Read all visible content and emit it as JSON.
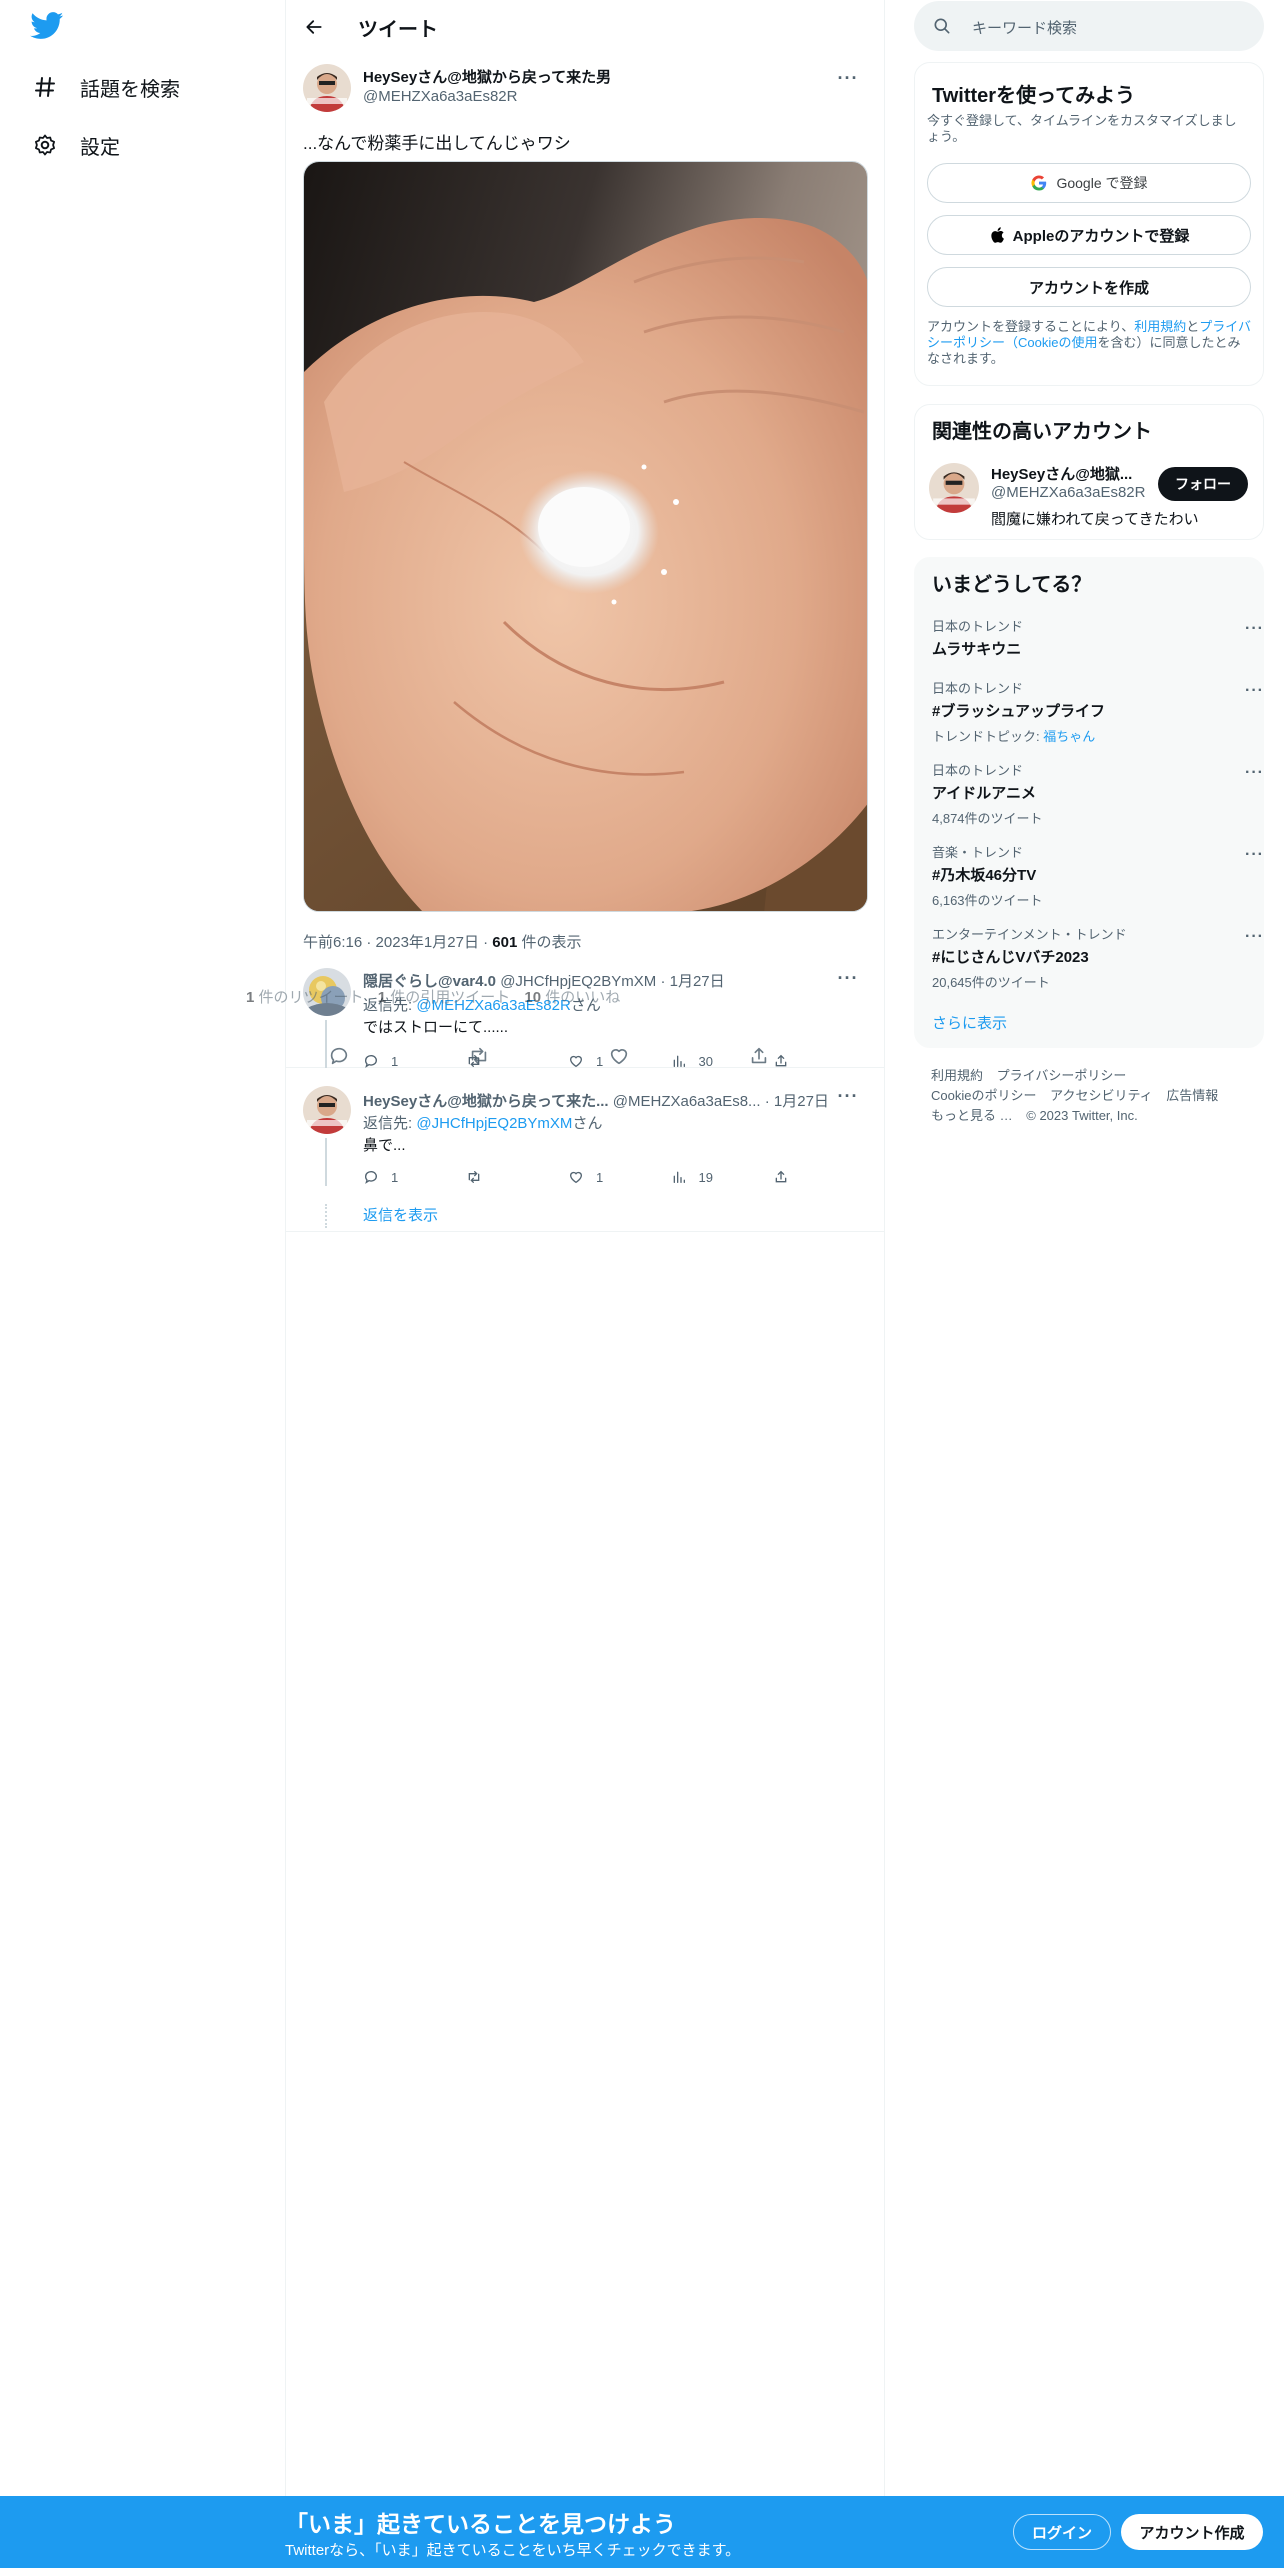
{
  "colors": {
    "accent": "#1d9bf0",
    "text": "#0f1419",
    "secondary": "#536471",
    "border": "#eff3f4"
  },
  "left_nav": {
    "logo_icon": "twitter-bird-icon",
    "items": [
      {
        "label": "話題を検索",
        "icon": "hashtag-icon"
      },
      {
        "label": "設定",
        "icon": "gear-icon"
      }
    ]
  },
  "header": {
    "back_icon": "arrow-left-icon",
    "title": "ツイート"
  },
  "main_tweet": {
    "display_name": "HeySeyさん@地獄から戻って来た男",
    "handle": "@MEHZXa6a3aEs82R",
    "text": "...なんで粉薬手に出してんじゃワシ",
    "photo_description": "hand-with-white-granules-photo",
    "time": "午前6:16",
    "date": "2023年1月27日",
    "views_count": "601",
    "views_label": "件の表示",
    "retweets_count": "1",
    "retweets_label": "件のリツイート",
    "quotes_count": "1",
    "quotes_label": "件の引用ツイート",
    "likes_count": "10",
    "likes_label": "件のいいね"
  },
  "replies": [
    {
      "display_name": "隠居ぐらし@var4.0",
      "handle": "@JHCfHpjEQ2BYmXM",
      "date": "1月27日",
      "reply_to_prefix": "返信先: ",
      "reply_to_handle": "@MEHZXa6a3aEs82R",
      "reply_to_suffix": "さん",
      "text": "ではストローにて......",
      "reply_count": "1",
      "retweet_count": "",
      "like_count": "1",
      "view_count": "30"
    },
    {
      "display_name": "HeySeyさん@地獄から戻って来た...",
      "handle": "@MEHZXa6a3aEs8...",
      "date": "1月27日",
      "reply_to_prefix": "返信先: ",
      "reply_to_handle": "@JHCfHpjEQ2BYmXM",
      "reply_to_suffix": "さん",
      "text": "鼻で...",
      "reply_count": "1",
      "retweet_count": "",
      "like_count": "1",
      "view_count": "19"
    }
  ],
  "show_replies": "返信を表示",
  "search": {
    "placeholder": "キーワード検索"
  },
  "signup_card": {
    "title": "Twitterを使ってみよう",
    "subtitle": "今すぐ登録して、タイムラインをカスタマイズしましょう。",
    "google_label": "Google で登録",
    "apple_label": "Appleのアカウントで登録",
    "create_label": "アカウントを作成",
    "terms_prefix": "アカウントを登録することにより、",
    "terms_link1": "利用規約",
    "terms_and": "と",
    "terms_link2": "プライバシーポリシー（Cookieの使用",
    "terms_suffix": "を含む）に同意したとみなされます。"
  },
  "related_card": {
    "title": "関連性の高いアカウント",
    "name": "HeySeyさん@地獄...",
    "handle": "@MEHZXa6a3aEs82R",
    "bio": "閻魔に嫌われて戻ってきたわい",
    "follow_label": "フォロー"
  },
  "trends_card": {
    "title": "いまどうしてる？",
    "items": [
      {
        "category": "日本のトレンド",
        "name": "ムラサキウニ",
        "count": "",
        "topic_prefix": "",
        "topic_link": ""
      },
      {
        "category": "日本のトレンド",
        "name": "#ブラッシュアップライフ",
        "count": "",
        "topic_prefix": "トレンドトピック: ",
        "topic_link": "福ちゃん"
      },
      {
        "category": "日本のトレンド",
        "name": "アイドルアニメ",
        "count": "4,874件のツイート",
        "topic_prefix": "",
        "topic_link": ""
      },
      {
        "category": "音楽・トレンド",
        "name": "#乃木坂46分TV",
        "count": "6,163件のツイート",
        "topic_prefix": "",
        "topic_link": ""
      },
      {
        "category": "エンターテインメント・トレンド",
        "name": "#にじさんじVバチ2023",
        "count": "20,645件のツイート",
        "topic_prefix": "",
        "topic_link": ""
      }
    ],
    "show_more": "さらに表示"
  },
  "footer": {
    "links": [
      "利用規約",
      "プライバシーポリシー",
      "Cookieのポリシー",
      "アクセシビリティ",
      "広告情報",
      "もっと見る …",
      "© 2023 Twitter, Inc."
    ]
  },
  "bottom_bar": {
    "title": "「いま」起きていることを見つけよう",
    "subtitle": "Twitterなら、「いま」起きていることをいち早くチェックできます。",
    "login_label": "ログイン",
    "signup_label": "アカウント作成"
  }
}
